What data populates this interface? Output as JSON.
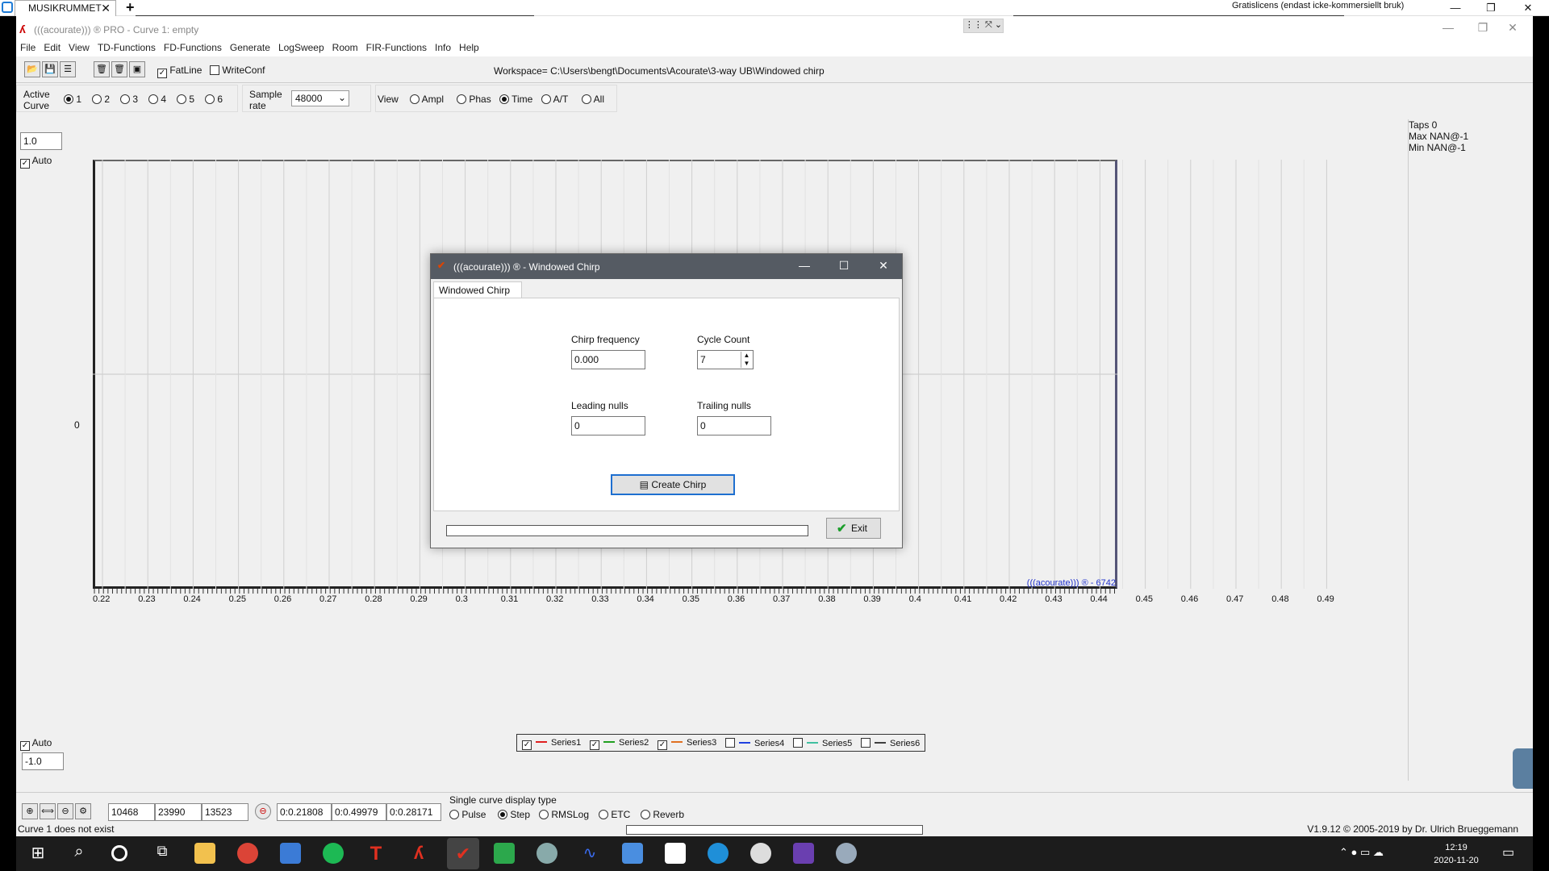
{
  "session": {
    "tab_label": "MUSIKRUMMET",
    "license_text": "Gratislicens (endast icke-kommersiellt bruk)"
  },
  "app": {
    "title": "(((acourate))) ® PRO - Curve 1: empty",
    "menu": [
      "File",
      "Edit",
      "View",
      "TD-Functions",
      "FD-Functions",
      "Generate",
      "LogSweep",
      "Room",
      "FIR-Functions",
      "Info",
      "Help"
    ],
    "toolbar": {
      "fatline_label": "FatLine",
      "writeconf_label": "WriteConf",
      "workspace": "Workspace= C:\\Users\\bengt\\Documents\\Acourate\\3-way UB\\Windowed chirp"
    },
    "controls": {
      "active_curve_label": "Active Curve",
      "curves": [
        "1",
        "2",
        "3",
        "4",
        "5",
        "6"
      ],
      "selected_curve": "1",
      "sample_rate_label": "Sample rate",
      "sample_rate_value": "48000",
      "view_label": "View",
      "views": [
        "Ampl",
        "Phas",
        "Time",
        "A/T",
        "All"
      ],
      "selected_view": "Time"
    },
    "plot": {
      "y_max_value": "1.0",
      "y_min_value": "-1.0",
      "auto_label": "Auto",
      "zero_label": "0",
      "x_ticks": [
        "0.22",
        "0.23",
        "0.24",
        "0.25",
        "0.26",
        "0.27",
        "0.28",
        "0.29",
        "0.3",
        "0.31",
        "0.32",
        "0.33",
        "0.34",
        "0.35",
        "0.36",
        "0.37",
        "0.38",
        "0.39",
        "0.4",
        "0.41",
        "0.42",
        "0.43",
        "0.44",
        "0.45",
        "0.46",
        "0.47",
        "0.48",
        "0.49"
      ],
      "watermark": "(((acourate))) ® - 6742"
    },
    "info": {
      "taps": "Taps 0",
      "max": "Max NAN@-1",
      "min": "Min NAN@-1"
    },
    "legend": [
      {
        "name": "Series1",
        "checked": true,
        "color": "#e02020"
      },
      {
        "name": "Series2",
        "checked": true,
        "color": "#20a020"
      },
      {
        "name": "Series3",
        "checked": true,
        "color": "#e07020"
      },
      {
        "name": "Series4",
        "checked": false,
        "color": "#2040e0"
      },
      {
        "name": "Series5",
        "checked": false,
        "color": "#40c0a0"
      },
      {
        "name": "Series6",
        "checked": false,
        "color": "#404040"
      }
    ],
    "bottom": {
      "sample_fields": [
        "10468",
        "23990",
        "13523"
      ],
      "time_fields": [
        "0:0.21808",
        "0:0.49979",
        "0:0.28171"
      ],
      "display_type_label": "Single curve display type",
      "display_types": [
        "Pulse",
        "Step",
        "RMSLog",
        "ETC",
        "Reverb"
      ],
      "selected_display_type": "Step"
    },
    "status_left": "Curve 1 does not exist",
    "status_right": "V1.9.12 © 2005-2019 by Dr. Ulrich Brueggemann"
  },
  "dialog": {
    "title": "(((acourate))) ® - Windowed Chirp",
    "tab": "Windowed Chirp",
    "chirp_frequency_label": "Chirp frequency",
    "chirp_frequency_value": "0.000",
    "cycle_count_label": "Cycle Count",
    "cycle_count_value": "7",
    "leading_nulls_label": "Leading nulls",
    "leading_nulls_value": "0",
    "trailing_nulls_label": "Trailing nulls",
    "trailing_nulls_value": "0",
    "create_button": "Create Chirp",
    "exit_button": "Exit",
    "progress": 0
  },
  "taskbar": {
    "time": "12:19",
    "date": "2020-11-20",
    "notification_count": "1"
  }
}
